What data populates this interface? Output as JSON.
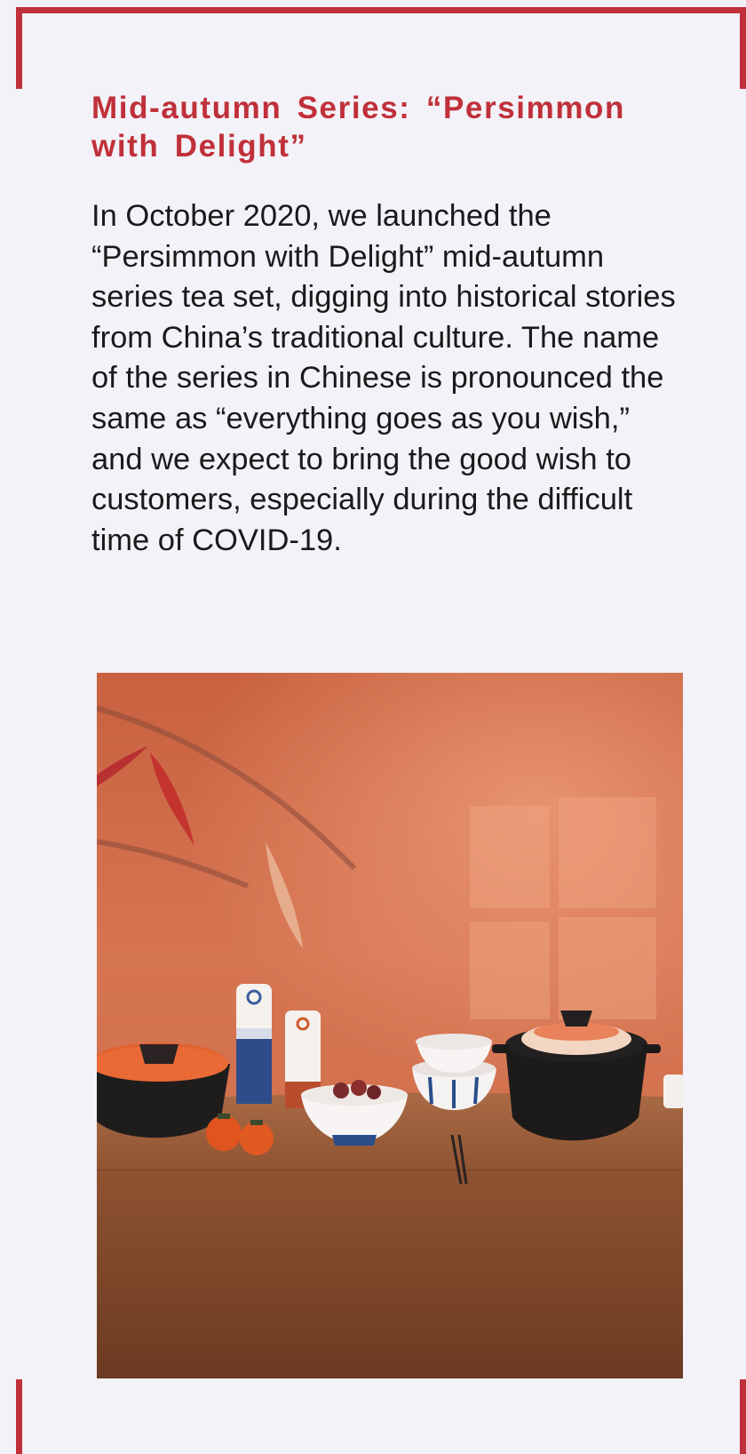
{
  "article": {
    "title": "Mid-autumn Series: “Persimmon with Delight”",
    "body": "In October 2020, we launched the “Persimmon with Delight” mid-autumn series tea set, digging into historical stories from China’s traditional culture. The name of the series in Chinese is pronounced the same as “everything goes as you wish,” and we expect to bring the good wish to customers, especially during the difficult time of COVID-19."
  },
  "colors": {
    "accent": "#c0303a",
    "background": "#f3f2f8",
    "text": "#1a1a1a"
  }
}
